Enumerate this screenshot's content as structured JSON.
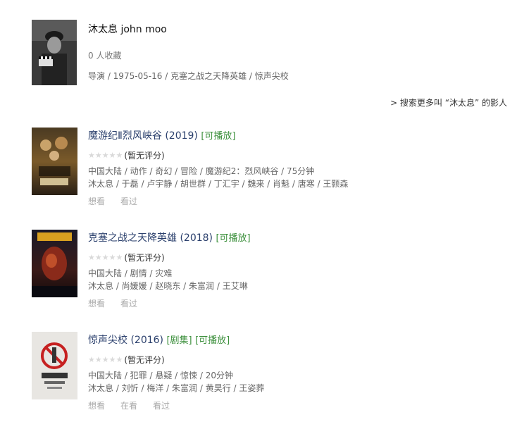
{
  "person": {
    "name": "沐太息 john moo",
    "favorites": "0 人收藏",
    "meta": "导演 / 1975-05-16 / 克塞之战之天降英雄 / 惊声尖校",
    "search_more": "> 搜索更多叫 “沐太息” 的影人"
  },
  "movies": [
    {
      "title": "魔游纪Ⅱ烈风峡谷 (2019)",
      "tags": [
        "[可播放]"
      ],
      "rating_text": "(暂无评分)",
      "info": "中国大陆 / 动作 / 奇幻 / 冒险 / 魔游纪2：烈风峡谷 / 75分钟",
      "cast": "沐太息 / 于磊 / 卢宇静 / 胡世群 / 丁汇宇 / 魏来 / 肖魁 / 唐寒 / 王颢森",
      "actions": [
        "想看",
        "看过"
      ]
    },
    {
      "title": "克塞之战之天降英雄 (2018)",
      "tags": [
        "[可播放]"
      ],
      "rating_text": "(暂无评分)",
      "info": "中国大陆 / 剧情 / 灾难",
      "cast": "沐太息 / 尚媛媛 / 赵晓东 / 朱富润 / 王艾琳",
      "actions": [
        "想看",
        "看过"
      ]
    },
    {
      "title": "惊声尖校 (2016)",
      "tags": [
        "[剧集]",
        "[可播放]"
      ],
      "rating_text": "(暂无评分)",
      "info": "中国大陆 / 犯罪 / 悬疑 / 惊悚 / 20分钟",
      "cast": "沐太息 / 刘忻 / 梅洋 / 朱富润 / 黄昊行 / 王姿葬",
      "actions": [
        "想看",
        "在看",
        "看过"
      ]
    }
  ],
  "colors": {
    "title_blue": "#2a3f6c",
    "playable_green": "#3b8f3b",
    "muted": "#aaaaaa"
  },
  "icons": {
    "star": "star-icon"
  }
}
